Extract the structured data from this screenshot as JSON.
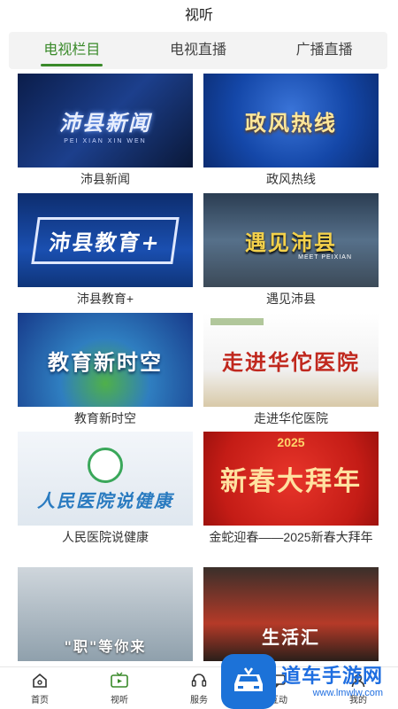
{
  "header": {
    "title": "视听"
  },
  "tabs": [
    {
      "label": "电视栏目",
      "active": true
    },
    {
      "label": "电视直播",
      "active": false
    },
    {
      "label": "广播直播",
      "active": false
    }
  ],
  "programs": [
    {
      "caption": "沛县新闻",
      "thumb_text": "沛县新闻",
      "thumb_sub": "PEI XIAN XIN WEN"
    },
    {
      "caption": "政风热线",
      "thumb_text": "政风热线"
    },
    {
      "caption": "沛县教育+",
      "thumb_text": "沛县教育+"
    },
    {
      "caption": "遇见沛县",
      "thumb_text": "遇见沛县",
      "thumb_sub": "MEET PEIXIAN"
    },
    {
      "caption": "教育新时空",
      "thumb_text": "教育新时空"
    },
    {
      "caption": "走进华佗医院",
      "thumb_text": "走进华佗医院"
    },
    {
      "caption": "人民医院说健康",
      "thumb_text": "人民医院说健康"
    },
    {
      "caption": "金蛇迎春——2025新春大拜年",
      "thumb_text": "新春大拜年",
      "thumb_year": "2025"
    },
    {
      "caption": "",
      "thumb_text": "\"职\"等你来"
    },
    {
      "caption": "",
      "thumb_text": "生活汇"
    }
  ],
  "bottom_nav": [
    {
      "label": "首页",
      "icon": "home-icon"
    },
    {
      "label": "视听",
      "icon": "tv-icon",
      "active": true
    },
    {
      "label": "服务",
      "icon": "headset-icon"
    },
    {
      "label": "互动",
      "icon": "chat-icon"
    },
    {
      "label": "我的",
      "icon": "user-icon"
    }
  ],
  "watermark": {
    "main": "道车手游网",
    "sub": "www.lmwlw.com"
  },
  "colors": {
    "accent": "#3a8a2a",
    "watermark": "#1f6ee0"
  }
}
